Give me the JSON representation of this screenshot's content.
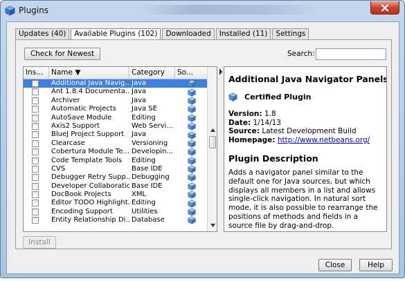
{
  "window": {
    "title": "Plugins",
    "app_icon": "netbeans-plugin-icon",
    "close_icon": "close-icon"
  },
  "tabs": [
    {
      "label": "Updates (40)",
      "active": false
    },
    {
      "label": "Available Plugins (102)",
      "active": true
    },
    {
      "label": "Downloaded",
      "active": false
    },
    {
      "label": "Installed (11)",
      "active": false
    },
    {
      "label": "Settings",
      "active": false
    }
  ],
  "toolbar": {
    "check_label": "Check for Newest",
    "search_label": "Search:",
    "search_value": ""
  },
  "table": {
    "columns": [
      "Ins...",
      "Name ▼",
      "Category",
      "So..."
    ],
    "source_icon": "certified-cube-icon",
    "rows": [
      {
        "name": "Additional Java Navig...",
        "category": "Java",
        "selected": true
      },
      {
        "name": "Ant 1.8.4 Documenta...",
        "category": "Java",
        "selected": false
      },
      {
        "name": "Archiver",
        "category": "Java",
        "selected": false
      },
      {
        "name": "Automatic Projects",
        "category": "Java SE",
        "selected": false
      },
      {
        "name": "AutoSave Module",
        "category": "Editing",
        "selected": false
      },
      {
        "name": "Axis2 Support",
        "category": "Web Servi...",
        "selected": false
      },
      {
        "name": "BlueJ Project Support",
        "category": "Java",
        "selected": false
      },
      {
        "name": "Clearcase",
        "category": "Versioning",
        "selected": false
      },
      {
        "name": "Cobertura Module Te...",
        "category": "Developin...",
        "selected": false
      },
      {
        "name": "Code Template Tools",
        "category": "Editing",
        "selected": false
      },
      {
        "name": "CVS",
        "category": "Base IDE",
        "selected": false
      },
      {
        "name": "Debugger Retry Supp...",
        "category": "Debugging",
        "selected": false
      },
      {
        "name": "Developer Collaboration",
        "category": "Base IDE",
        "selected": false
      },
      {
        "name": "DocBook Projects",
        "category": "XML",
        "selected": false
      },
      {
        "name": "Editor TODO Highlight...",
        "category": "Editing",
        "selected": false
      },
      {
        "name": "Encoding Support",
        "category": "Utilities",
        "selected": false
      },
      {
        "name": "Entity Relationship Di...",
        "category": "Database",
        "selected": false
      }
    ]
  },
  "detail": {
    "title": "Additional Java Navigator Panels",
    "certified_label": "Certified Plugin",
    "version_label": "Version:",
    "version": "1.8",
    "date_label": "Date:",
    "date": "1/14/13",
    "source_label": "Source:",
    "source": "Latest Development Build",
    "homepage_label": "Homepage:",
    "homepage": "http://www.netbeans.org/",
    "desc_heading": "Plugin Description",
    "description": "Adds a navigator panel similar to the default one for Java sources, but which displays all members in a list and allows single-click navigation. In natural sort mode, it is also possible to rearrange the positions of methods and fields in a source file by drag-and-drop."
  },
  "buttons": {
    "install": "Install",
    "close": "Close",
    "help": "Help"
  }
}
